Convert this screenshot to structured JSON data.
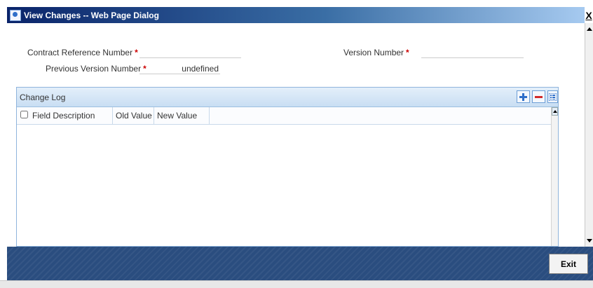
{
  "window": {
    "title": "View Changes -- Web Page Dialog",
    "close_glyph": "X"
  },
  "form": {
    "contract_ref_label": "Contract Reference Number",
    "contract_ref_value": "",
    "prev_version_label": "Previous Version Number",
    "prev_version_value": "undefined",
    "version_label": "Version Number",
    "version_value": "",
    "required_marker": "*"
  },
  "grid": {
    "title": "Change Log",
    "add_icon": "plus-icon",
    "delete_icon": "minus-icon",
    "view_icon": "list-icon",
    "columns": [
      "Field Description",
      "Old Value",
      "New Value"
    ],
    "rows": []
  },
  "footer": {
    "exit_label": "Exit"
  },
  "colors": {
    "accent": "#2a4d7f",
    "required": "#cc0000",
    "grid_border": "#8fb4dc",
    "add_icon": "#2f6fc9",
    "delete_icon": "#d22b2b"
  }
}
